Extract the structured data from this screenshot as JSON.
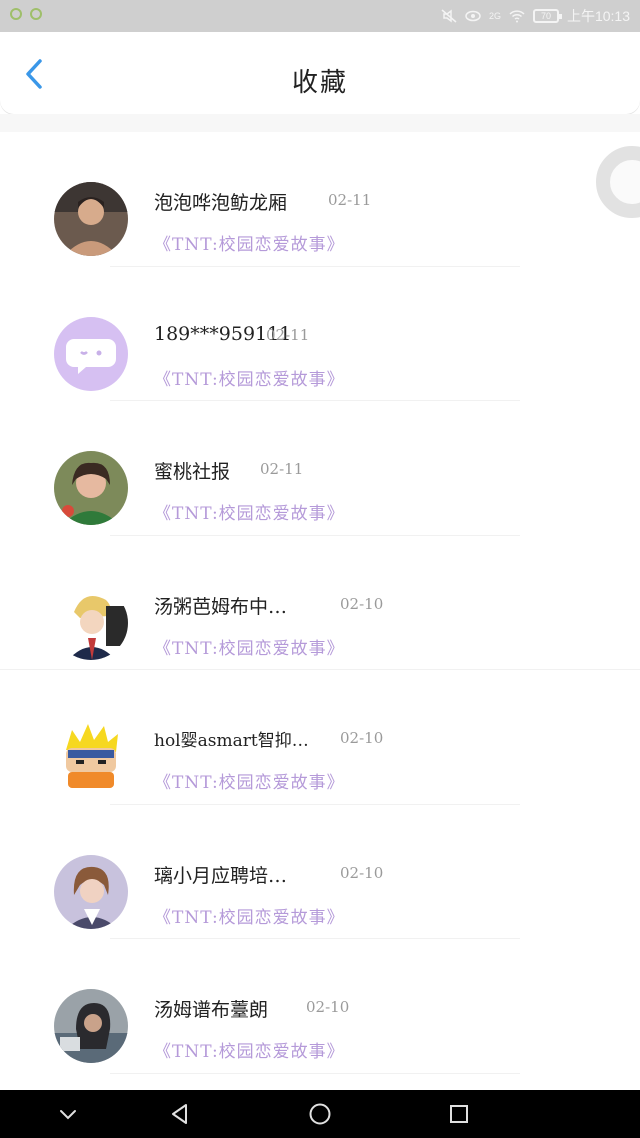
{
  "status_bar": {
    "battery": "70",
    "network": "2G",
    "time": "上午10:13",
    "icons": [
      "notification-icon",
      "notification-icon",
      "mute-icon",
      "eye-icon",
      "wifi-icon",
      "battery-icon"
    ]
  },
  "header": {
    "title": "收藏",
    "back_icon": "chevron-left-icon"
  },
  "favorites": [
    {
      "name": "泡泡哗泡鲂龙厢",
      "date": "02-11",
      "story": "《TNT:校园恋爱故事》",
      "avatar": "photo"
    },
    {
      "name": "189***959111",
      "date": "02-11",
      "story": "《TNT:校园恋爱故事》",
      "avatar": "default-chat"
    },
    {
      "name": "蜜桃社报",
      "date": "02-11",
      "story": "《TNT:校园恋爱故事》",
      "avatar": "photo"
    },
    {
      "name": "汤粥芭姆布中…",
      "date": "02-10",
      "story": "《TNT:校园恋爱故事》",
      "avatar": "anime"
    },
    {
      "name": "hol婴asmart智抑…",
      "date": "02-10",
      "story": "《TNT:校园恋爱故事》",
      "avatar": "cartoon"
    },
    {
      "name": "璃小月应聘培…",
      "date": "02-10",
      "story": "《TNT:校园恋爱故事》",
      "avatar": "illustration"
    },
    {
      "name": "汤姆谱布薹朗",
      "date": "02-10",
      "story": "《TNT:校园恋爱故事》",
      "avatar": "photo"
    }
  ],
  "colors": {
    "accent": "#3a97e8",
    "story": "#b59ad9",
    "status_bar": "#cfcfcf"
  },
  "nav": [
    "chevron-down-icon",
    "back-triangle-icon",
    "home-circle-icon",
    "recents-square-icon"
  ]
}
